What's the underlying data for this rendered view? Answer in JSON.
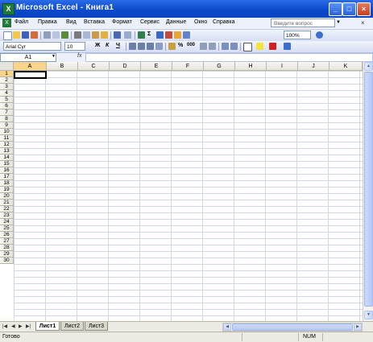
{
  "window": {
    "app_icon": "excel-icon",
    "title": "Microsoft Excel - Книга1",
    "minimize": "_",
    "maximize": "□",
    "close": "×"
  },
  "menu": {
    "items": [
      "Файл",
      "Правка",
      "Вид",
      "Вставка",
      "Формат",
      "Сервис",
      "Данные",
      "Окно",
      "Справка"
    ],
    "help_placeholder": "Введите вопрос",
    "doc_close": "×"
  },
  "standard_toolbar": {
    "zoom": "100%",
    "sigma": "Σ"
  },
  "formatting_toolbar": {
    "font_name": "Arial Cyr",
    "font_size": "10",
    "bold": "Ж",
    "italic": "К",
    "underline": "Ч",
    "percent": "%",
    "thousands": "000"
  },
  "formula_bar": {
    "name_box": "A1",
    "fx": "fx",
    "value": ""
  },
  "grid": {
    "columns": [
      "A",
      "B",
      "C",
      "D",
      "E",
      "F",
      "G",
      "H",
      "I",
      "J",
      "K"
    ],
    "rows": [
      "1",
      "2",
      "3",
      "4",
      "5",
      "6",
      "7",
      "8",
      "9",
      "10",
      "11",
      "12",
      "13",
      "14",
      "15",
      "16",
      "17",
      "18",
      "19",
      "20",
      "21",
      "22",
      "23",
      "24",
      "25",
      "26",
      "27",
      "28",
      "29",
      "30"
    ],
    "active_cell": "A1"
  },
  "sheets": {
    "tabs": [
      "Лист1",
      "Лист2",
      "Лист3"
    ],
    "active": "Лист1"
  },
  "status": {
    "text": "Готово",
    "num": "NUM"
  },
  "colors": {
    "title_bar": "#0a48c9",
    "selection_header": "#f8d48a",
    "gridline": "#d0d7e5"
  }
}
